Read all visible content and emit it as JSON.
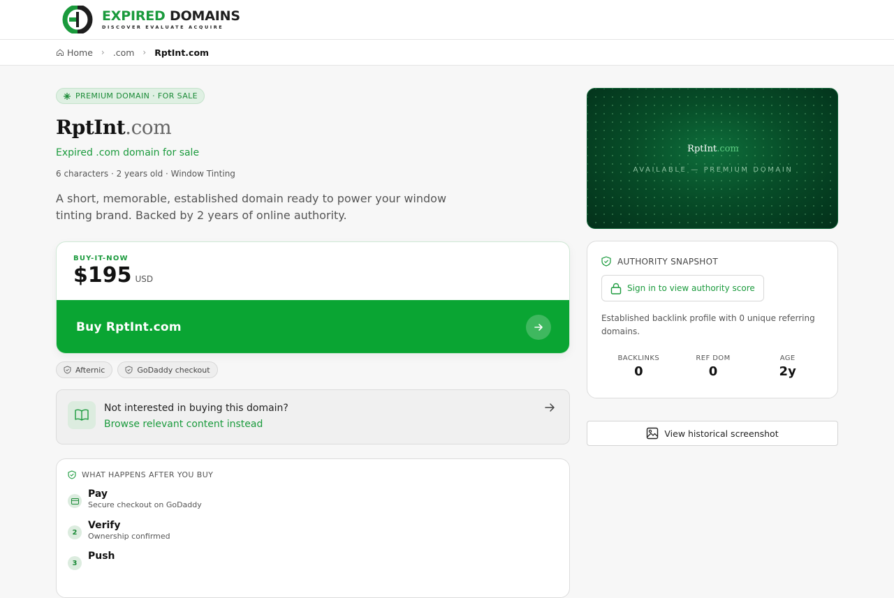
{
  "brand": {
    "name_part1": "EXPIRED",
    "name_part2": "DOMAINS",
    "tagline": "DISCOVER EVALUATE ACQUIRE",
    "accent": "#1a9a3c"
  },
  "breadcrumb": {
    "home": "Home",
    "tld": ".com",
    "current": "RptInt.com"
  },
  "badge": "PREMIUM DOMAIN · FOR SALE",
  "domain": {
    "name": "RptInt",
    "tld": ".com"
  },
  "subtitle": "Expired .com domain for sale",
  "meta": "6 characters · 2 years old · Window Tinting",
  "description": "A short, memorable, established domain ready to power your window tinting brand. Backed by 2 years of online authority.",
  "buy": {
    "label": "BUY-IT-NOW",
    "price": "$195",
    "currency": "USD",
    "button": "Buy RptInt.com",
    "button_color": "#0aa533"
  },
  "chips": [
    "Afternic",
    "GoDaddy checkout"
  ],
  "browse": {
    "question": "Not interested in buying this domain?",
    "link": "Browse relevant content instead"
  },
  "steps": {
    "heading": "WHAT HAPPENS AFTER YOU BUY",
    "items": [
      {
        "num": "",
        "title": "Pay",
        "sub": "Secure checkout on GoDaddy"
      },
      {
        "num": "2",
        "title": "Verify",
        "sub": "Ownership confirmed"
      },
      {
        "num": "3",
        "title": "Push",
        "sub": ""
      }
    ]
  },
  "hero": {
    "name": "RptInt",
    "tld": ".com",
    "availability": "AVAILABLE — PREMIUM DOMAIN"
  },
  "authority": {
    "heading": "AUTHORITY SNAPSHOT",
    "signin": "Sign in to view authority score",
    "description": "Established backlink profile with 0 unique referring domains.",
    "stats": [
      {
        "label": "BACKLINKS",
        "value": "0"
      },
      {
        "label": "REF DOM",
        "value": "0"
      },
      {
        "label": "AGE",
        "value": "2y"
      }
    ]
  },
  "history_button": "View historical screenshot"
}
